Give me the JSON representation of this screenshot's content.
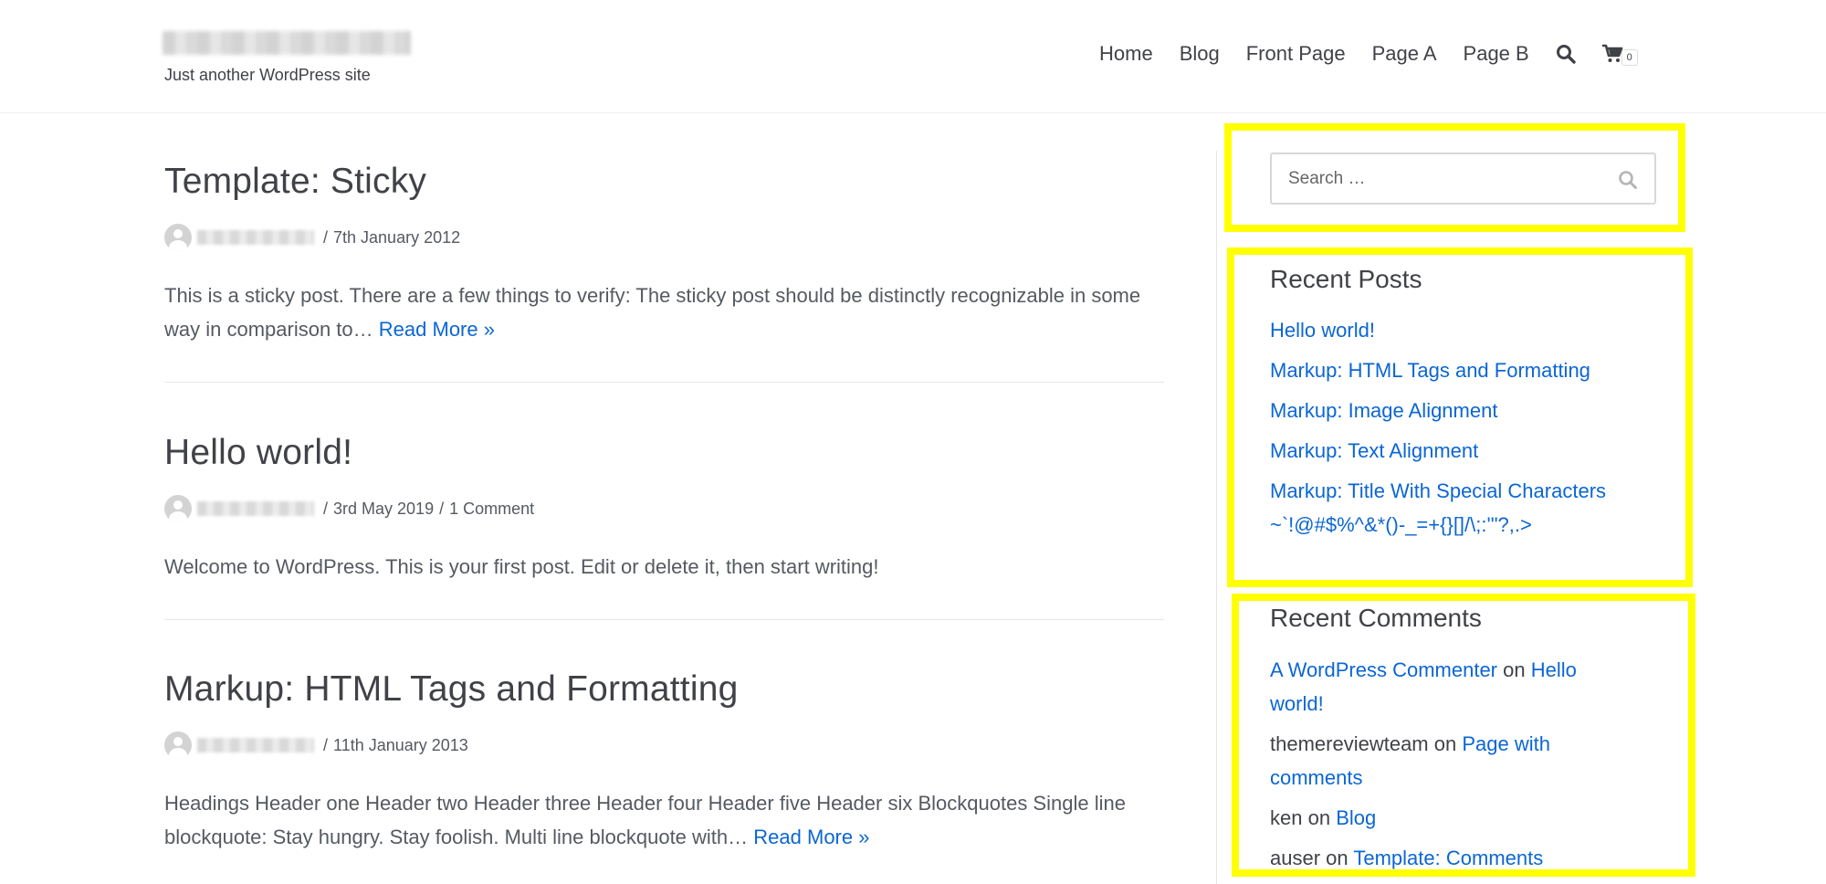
{
  "site": {
    "tagline": "Just another WordPress site"
  },
  "nav": {
    "items": [
      "Home",
      "Blog",
      "Front Page",
      "Page A",
      "Page B"
    ],
    "cart_count": "0"
  },
  "posts": [
    {
      "title": "Template: Sticky",
      "date": "7th January 2012",
      "comments": "",
      "excerpt": "This is a sticky post. There are a few things to verify: The sticky post should be distinctly recognizable in some way in comparison to…",
      "read_more": "Read More »"
    },
    {
      "title": "Hello world!",
      "date": "3rd May 2019",
      "comments": "1 Comment",
      "excerpt": "Welcome to WordPress. This is your first post. Edit or delete it, then start writing!",
      "read_more": ""
    },
    {
      "title": "Markup: HTML Tags and Formatting",
      "date": "11th January 2013",
      "comments": "",
      "excerpt": "Headings Header one Header two Header three Header four Header five Header six Blockquotes Single line blockquote: Stay hungry. Stay foolish. Multi line blockquote with…",
      "read_more": "Read More »"
    }
  ],
  "meta_separator": "/",
  "search": {
    "placeholder": "Search …"
  },
  "recent_posts": {
    "title": "Recent Posts",
    "items": [
      "Hello world!",
      "Markup: HTML Tags and Formatting",
      "Markup: Image Alignment",
      "Markup: Text Alignment",
      "Markup: Title With Special Characters ~`!@#$%^&*()-_=+{}[]/\\;:'\"?,.>"
    ]
  },
  "recent_comments": {
    "title": "Recent Comments",
    "on_word": "on",
    "items": [
      {
        "author": "A WordPress Commenter",
        "author_link": true,
        "post": "Hello world!"
      },
      {
        "author": "themereviewteam",
        "author_link": false,
        "post": "Page with comments"
      },
      {
        "author": "ken",
        "author_link": false,
        "post": "Blog"
      },
      {
        "author": "auser",
        "author_link": false,
        "post": "Template: Comments"
      }
    ]
  },
  "colors": {
    "link": "#0b66d4",
    "text": "#404248",
    "highlight": "#ffff00"
  }
}
